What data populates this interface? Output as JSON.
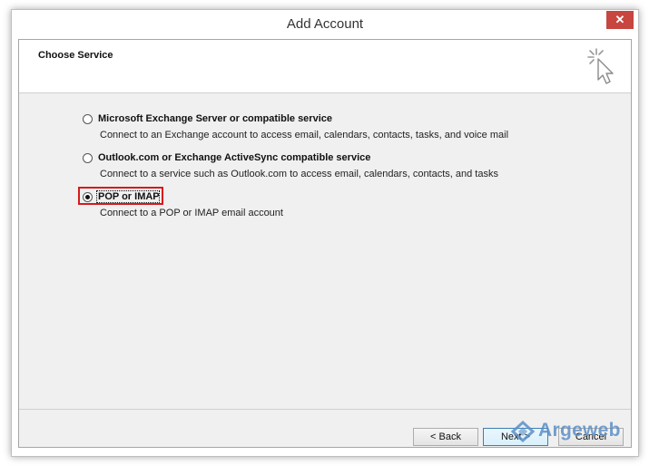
{
  "window": {
    "title": "Add Account",
    "close_glyph": "✕"
  },
  "header": {
    "title": "Choose Service",
    "icon": "cursor-click-icon"
  },
  "options": [
    {
      "label": "Microsoft Exchange Server or compatible service",
      "description": "Connect to an Exchange account to access email, calendars, contacts, tasks, and voice mail",
      "selected": false
    },
    {
      "label": "Outlook.com or Exchange ActiveSync compatible service",
      "description": "Connect to a service such as Outlook.com to access email, calendars, contacts, and tasks",
      "selected": false
    },
    {
      "label": "POP or IMAP",
      "description": "Connect to a POP or IMAP email account",
      "selected": true
    }
  ],
  "buttons": {
    "back": "< Back",
    "next": "Next >",
    "cancel": "Cancel"
  },
  "watermark": {
    "text": "Argeweb"
  },
  "colors": {
    "close_button": "#c7463f",
    "highlight_border": "#d7191c",
    "watermark": "#5b8fc7"
  }
}
